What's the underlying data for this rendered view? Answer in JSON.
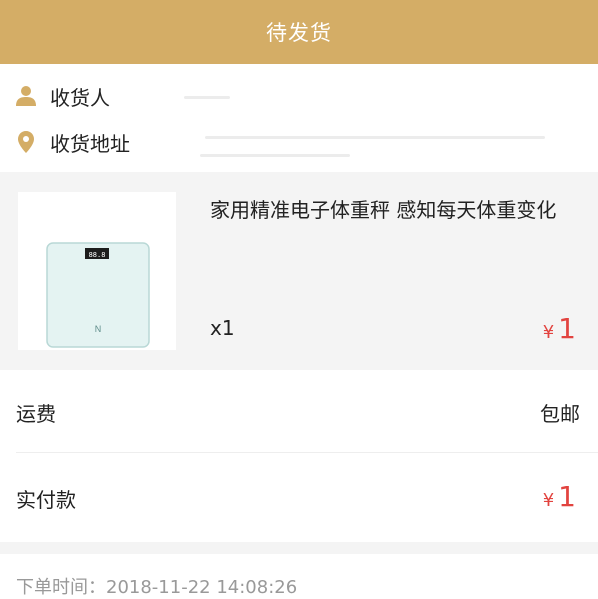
{
  "header": {
    "title": "待发货"
  },
  "recipient": {
    "icon": "person-icon",
    "label": "收货人"
  },
  "address": {
    "icon": "location-pin-icon",
    "label": "收货地址"
  },
  "product": {
    "name": "家用精准电子体重秤 感知每天体重变化",
    "quantity": "x1",
    "price_symbol": "¥",
    "price": "1",
    "image": "smart-scale-icon"
  },
  "shipping": {
    "label": "运费",
    "value": "包邮"
  },
  "payment": {
    "label": "实付款",
    "price_symbol": "¥",
    "price": "1"
  },
  "order_time": {
    "text": "下单时间：2018-11-22 14:08:26"
  },
  "colors": {
    "header_bg": "#d4ad66",
    "price_red": "#e2433f",
    "panel_bg": "#f4f4f4",
    "muted_text": "#999999"
  }
}
